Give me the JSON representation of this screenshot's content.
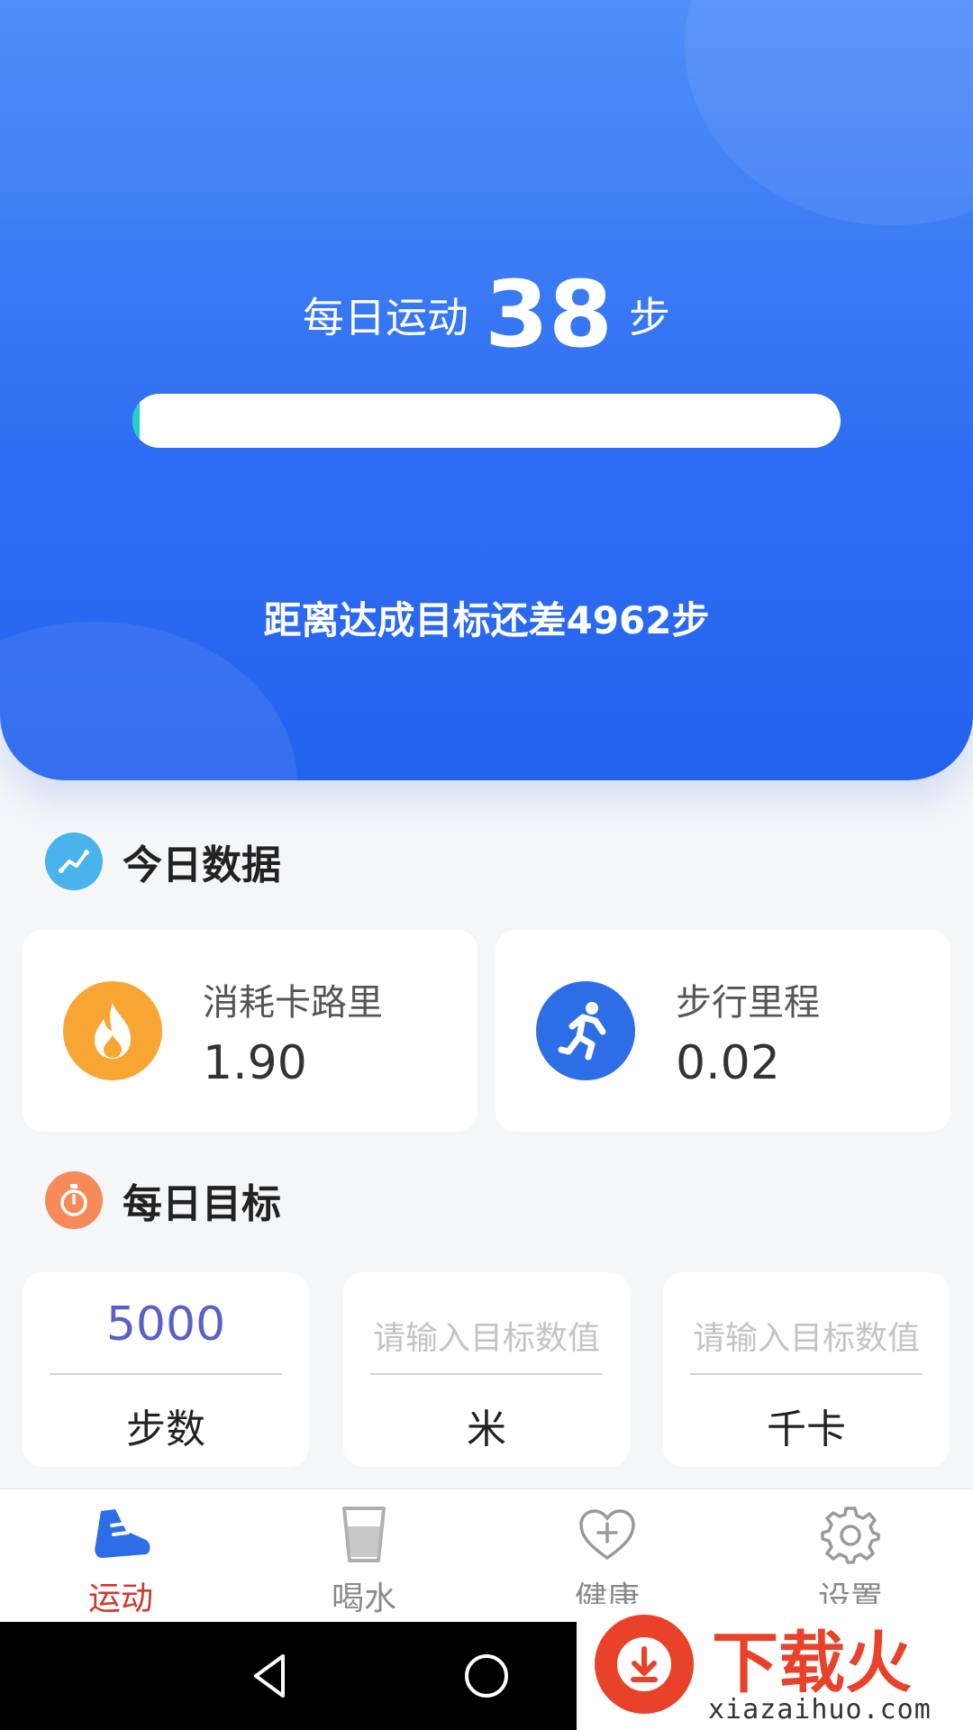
{
  "hero": {
    "label_prefix": "每日运动",
    "steps": "38",
    "label_suffix": "步",
    "progress_fraction": 0.0076,
    "remaining_text": "距离达成目标还差4962步"
  },
  "today_section": {
    "title": "今日数据"
  },
  "stats": [
    {
      "label": "消耗卡路里",
      "value": "1.90",
      "icon": "fire-icon",
      "color": "#f7a633"
    },
    {
      "label": "步行里程",
      "value": "0.02",
      "icon": "running-icon",
      "color": "#2d6ee6"
    }
  ],
  "goal_section": {
    "title": "每日目标"
  },
  "goals": [
    {
      "value": "5000",
      "placeholder": "请输入目标数值",
      "unit": "步数"
    },
    {
      "value": "",
      "placeholder": "请输入目标数值",
      "unit": "米"
    },
    {
      "value": "",
      "placeholder": "请输入目标数值",
      "unit": "千卡"
    }
  ],
  "tabs": [
    {
      "label": "运动",
      "icon": "shoe-icon",
      "active": true
    },
    {
      "label": "喝水",
      "icon": "cup-icon",
      "active": false
    },
    {
      "label": "健康",
      "icon": "heart-plus-icon",
      "active": false
    },
    {
      "label": "设置",
      "icon": "gear-icon",
      "active": false
    }
  ],
  "watermark": {
    "text": "下载火",
    "url": "xiazaihuo.com"
  },
  "colors": {
    "hero": "#2f6ff2",
    "progress_fill": "#22d0c8",
    "active_tab": "#d0392e",
    "goal_value": "#5b5fc7"
  }
}
